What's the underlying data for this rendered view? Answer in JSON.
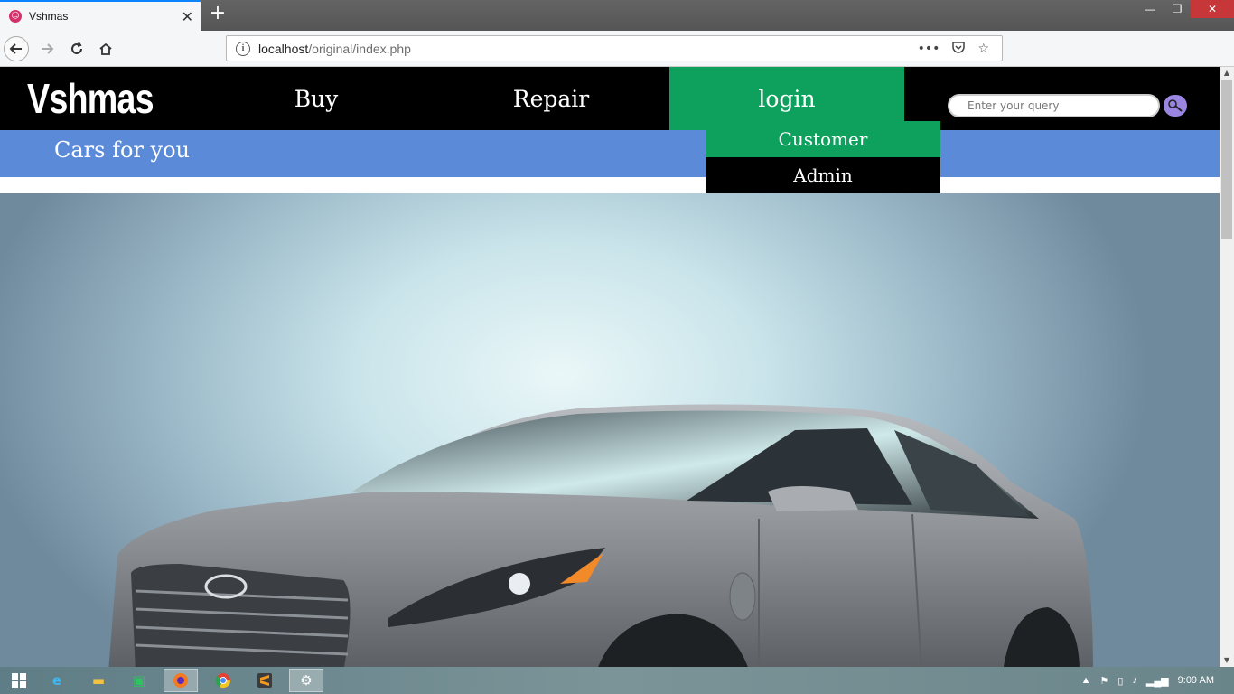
{
  "browser": {
    "tab_title": "Vshmas",
    "tab_close": "✕",
    "new_tab": "+",
    "url_host": "localhost",
    "url_path": "/original/index.php",
    "win_min": "—",
    "win_max": "❐",
    "win_close": "✕"
  },
  "site": {
    "logo": "Vshmas",
    "menu": {
      "buy": "Buy",
      "repair": "Repair",
      "login": "login"
    },
    "search_placeholder": "Enter your query",
    "tagline": "Cars for you",
    "dropdown": {
      "customer": "Customer",
      "admin": "Admin"
    },
    "accent_green": "#0ea15d",
    "accent_blue": "#5b8bd8"
  },
  "taskbar": {
    "time": "9:09 AM"
  }
}
